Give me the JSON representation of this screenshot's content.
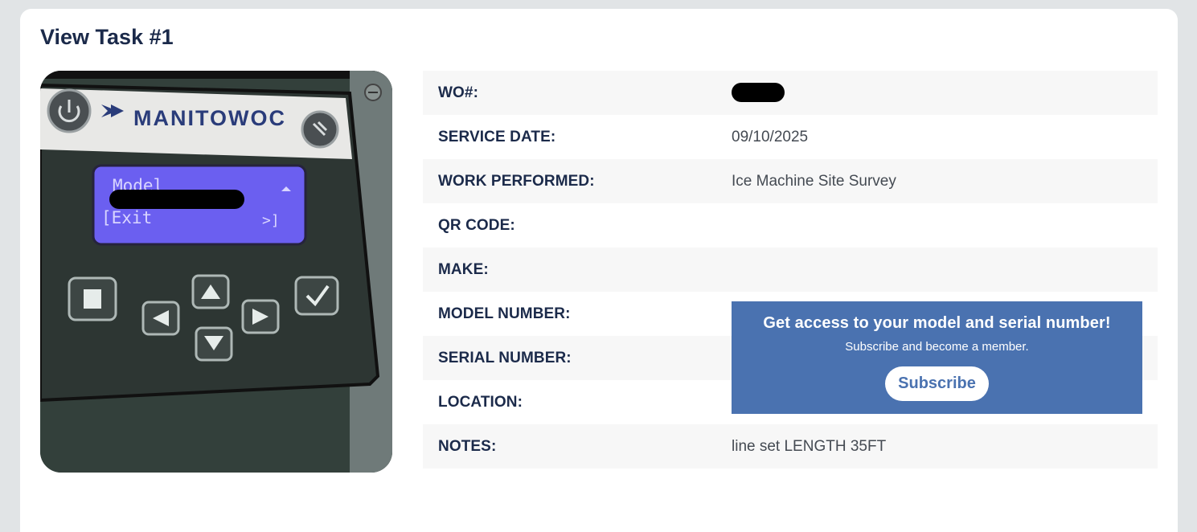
{
  "page": {
    "title": "View Task #1"
  },
  "photo": {
    "brand": "MANITOWOC",
    "display_line1": "Model",
    "display_line2": "[Exit",
    "display_arrow": ">]"
  },
  "details": [
    {
      "label": "WO#:",
      "value": "",
      "redacted": true
    },
    {
      "label": "SERVICE DATE:",
      "value": "09/10/2025"
    },
    {
      "label": "WORK PERFORMED:",
      "value": "Ice Machine Site Survey"
    },
    {
      "label": "QR CODE:",
      "value": ""
    },
    {
      "label": "MAKE:",
      "value": ""
    },
    {
      "label": "MODEL NUMBER:",
      "value": ""
    },
    {
      "label": "SERIAL NUMBER:",
      "value": ""
    },
    {
      "label": "LOCATION:",
      "value": ""
    },
    {
      "label": "NOTES:",
      "value": "line set LENGTH 35FT"
    }
  ],
  "promo": {
    "title": "Get access to your model and serial number!",
    "subtitle": "Subscribe and become a member.",
    "button": "Subscribe",
    "color": "#4a72b0"
  }
}
